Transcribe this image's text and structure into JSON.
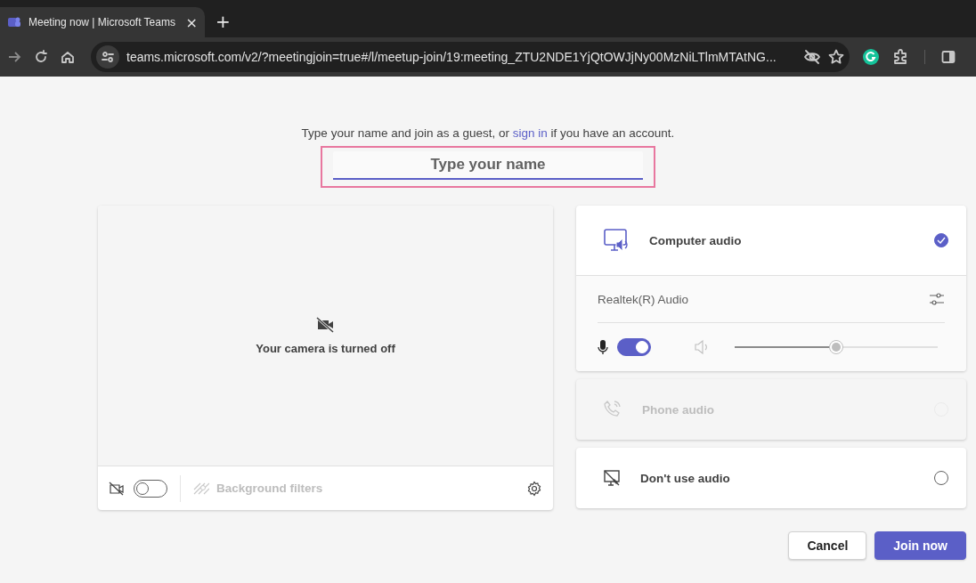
{
  "browser": {
    "tab": {
      "title": "Meeting now | Microsoft Teams",
      "close": "×",
      "selected": true
    },
    "new_tab": "+",
    "address": "teams.microsoft.com/v2/?meetingjoin=true#/l/meetup-join/19:meeting_ZTU2NDE1YjQtOWJjNy00MzNiLTlmMTAtNG..."
  },
  "prompt": {
    "before": "Type your name and join as a guest, or",
    "link": "sign in",
    "after": "if you have an account."
  },
  "name_field": {
    "placeholder": "Type your name",
    "highlighted": true
  },
  "camera": {
    "message": "Your camera is turned off",
    "on": false,
    "background_filters": {
      "label": "Background filters",
      "disabled": true
    }
  },
  "audio_options": [
    {
      "kind": "computer",
      "label": "Computer audio",
      "selected": true,
      "disabled": false,
      "device": "Realtek(R) Audio",
      "mic_on": true,
      "volume": {
        "level": 0.5
      }
    },
    {
      "kind": "phone",
      "label": "Phone audio",
      "selected": false,
      "disabled": true
    },
    {
      "kind": "none",
      "label": "Don't use audio",
      "selected": false,
      "disabled": false
    }
  ],
  "buttons": [
    {
      "label": "Cancel",
      "kind": "secondary"
    },
    {
      "label": "Join now",
      "kind": "primary"
    }
  ]
}
